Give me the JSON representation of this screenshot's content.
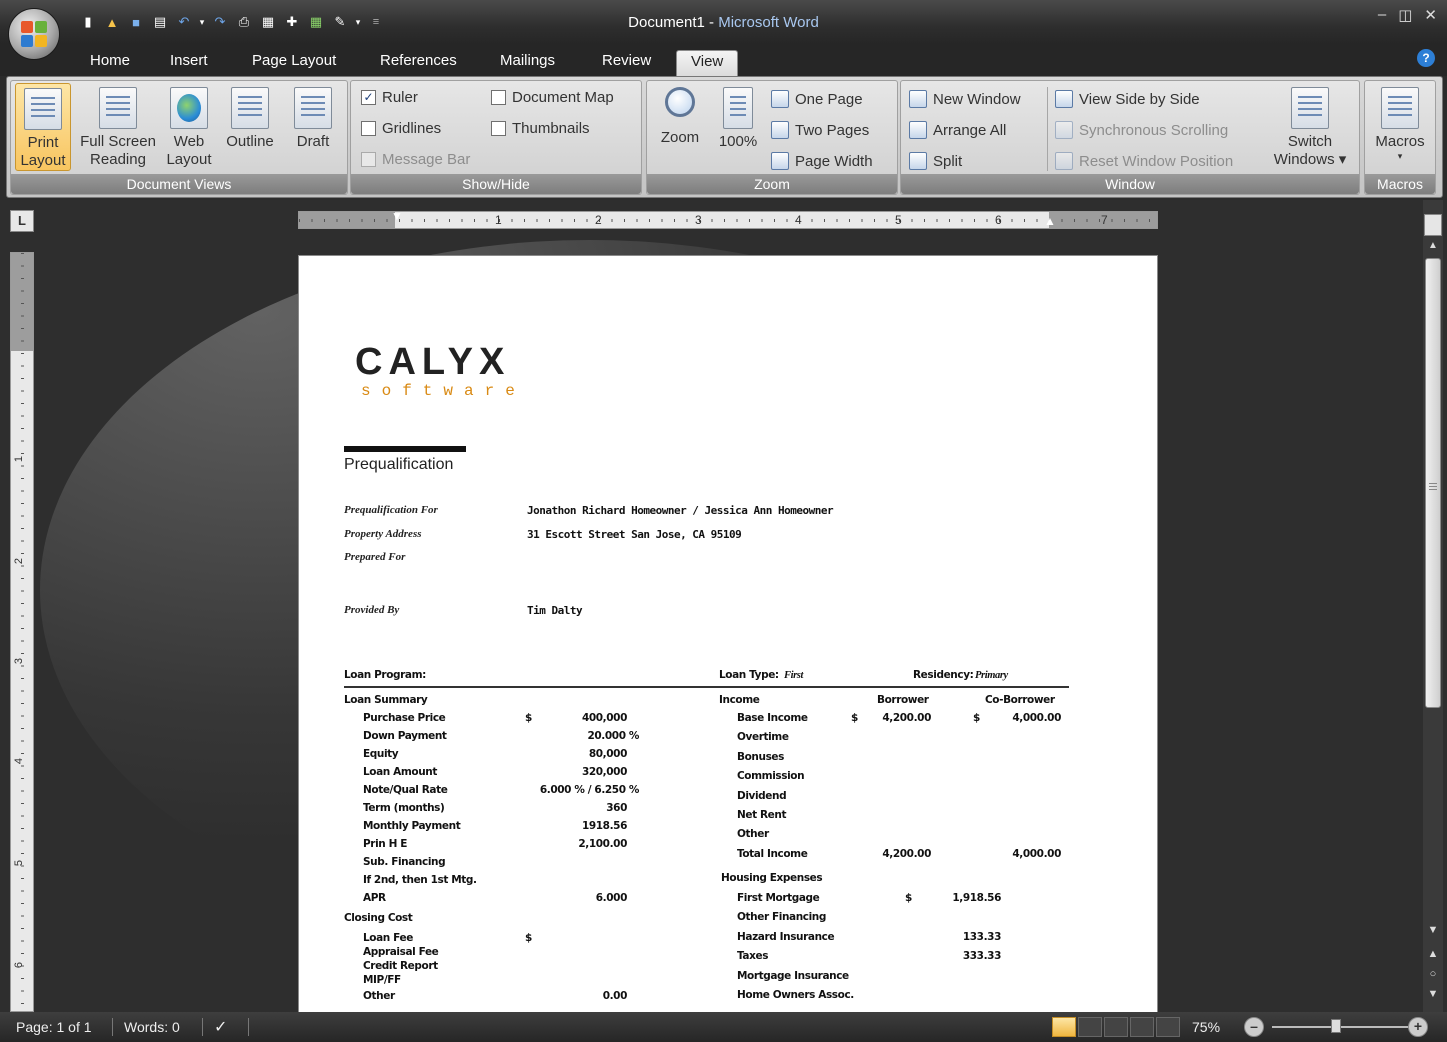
{
  "window": {
    "doc_title": "Document1",
    "separator": " - ",
    "app_name": "Microsoft Word"
  },
  "tabs": [
    "Home",
    "Insert",
    "Page Layout",
    "References",
    "Mailings",
    "Review",
    "View"
  ],
  "active_tab": "View",
  "ribbon": {
    "document_views": {
      "label": "Document Views",
      "print_layout": [
        "Print",
        "Layout"
      ],
      "full_screen": [
        "Full Screen",
        "Reading"
      ],
      "web_layout": [
        "Web",
        "Layout"
      ],
      "outline": "Outline",
      "draft": "Draft"
    },
    "show_hide": {
      "label": "Show/Hide",
      "ruler": "Ruler",
      "gridlines": "Gridlines",
      "message_bar": "Message Bar",
      "document_map": "Document Map",
      "thumbnails": "Thumbnails"
    },
    "zoom": {
      "label": "Zoom",
      "zoom": "Zoom",
      "hundred": "100%",
      "one_page": "One Page",
      "two_pages": "Two Pages",
      "page_width": "Page Width"
    },
    "window": {
      "label": "Window",
      "new_window": "New Window",
      "arrange_all": "Arrange All",
      "split": "Split",
      "side_by_side": "View Side by Side",
      "sync_scrolling": "Synchronous Scrolling",
      "reset_position": "Reset Window Position",
      "switch_windows": [
        "Switch",
        "Windows ▾"
      ]
    },
    "macros": {
      "label": "Macros",
      "macros": "Macros",
      "arrow": "▾"
    }
  },
  "ruler": {
    "h_numbers": [
      "1",
      "2",
      "3",
      "4",
      "5",
      "6",
      "7"
    ],
    "v_numbers": [
      "1",
      "2",
      "3",
      "4",
      "5",
      "6"
    ],
    "corner": "L"
  },
  "document": {
    "logo_main": "CALYX",
    "logo_sub": "software",
    "heading": "Prequalification",
    "fields": [
      {
        "label": "Prequalification For",
        "value": "Jonathon Richard Homeowner / Jessica Ann Homeowner"
      },
      {
        "label": "Property Address",
        "value": "31 Escott Street San Jose, CA 95109"
      },
      {
        "label": "Prepared For",
        "value": ""
      },
      {
        "label": "Provided By",
        "value": "Tim Dalty"
      }
    ],
    "loan_program_label": "Loan Program:",
    "loan_type_label": "Loan Type:",
    "loan_type_value": "First",
    "residency_label": "Residency:",
    "residency_value": "Primary",
    "loan_summary": "Loan Summary",
    "summary_rows": [
      {
        "label": "Purchase Price",
        "dollar": "$",
        "value": "400,000"
      },
      {
        "label": "Down Payment",
        "dollar": "",
        "value": "20.000 %"
      },
      {
        "label": "Equity",
        "dollar": "",
        "value": "80,000"
      },
      {
        "label": "Loan Amount",
        "dollar": "",
        "value": "320,000"
      },
      {
        "label": "Note/Qual Rate",
        "dollar": "",
        "value": "6.000 % / 6.250 %"
      },
      {
        "label": "Term (months)",
        "dollar": "",
        "value": "360"
      },
      {
        "label": "Monthly Payment",
        "dollar": "",
        "value": "1918.56"
      },
      {
        "label": "Prin H E",
        "dollar": "",
        "value": "2,100.00"
      },
      {
        "label": "Sub. Financing",
        "dollar": "",
        "value": ""
      },
      {
        "label": "If 2nd, then 1st Mtg.",
        "dollar": "",
        "value": ""
      },
      {
        "label": "APR",
        "dollar": "",
        "value": "6.000"
      }
    ],
    "closing_cost": "Closing Cost",
    "closing_rows": [
      {
        "label": "Loan Fee",
        "dollar": "$",
        "value": ""
      },
      {
        "label": "Appraisal Fee",
        "dollar": "",
        "value": ""
      },
      {
        "label": "Credit Report",
        "dollar": "",
        "value": ""
      },
      {
        "label": "MIP/FF",
        "dollar": "",
        "value": ""
      },
      {
        "label": "Other",
        "dollar": "",
        "value": "0.00"
      }
    ],
    "income_label": "Income",
    "borrower_label": "Borrower",
    "coborrower_label": "Co-Borrower",
    "income_rows": [
      {
        "label": "Base Income",
        "b_dollar": "$",
        "b": "4,200.00",
        "c_dollar": "$",
        "c": "4,000.00"
      },
      {
        "label": "Overtime",
        "b_dollar": "",
        "b": "",
        "c_dollar": "",
        "c": ""
      },
      {
        "label": "Bonuses",
        "b_dollar": "",
        "b": "",
        "c_dollar": "",
        "c": ""
      },
      {
        "label": "Commission",
        "b_dollar": "",
        "b": "",
        "c_dollar": "",
        "c": ""
      },
      {
        "label": "Dividend",
        "b_dollar": "",
        "b": "",
        "c_dollar": "",
        "c": ""
      },
      {
        "label": "Net Rent",
        "b_dollar": "",
        "b": "",
        "c_dollar": "",
        "c": ""
      },
      {
        "label": "Other",
        "b_dollar": "",
        "b": "",
        "c_dollar": "",
        "c": ""
      },
      {
        "label": "Total Income",
        "b_dollar": "",
        "b": "4,200.00",
        "c_dollar": "",
        "c": "4,000.00"
      }
    ],
    "housing_label": "Housing Expenses",
    "housing_rows": [
      {
        "label": "First Mortgage",
        "dollar": "$",
        "value": "1,918.56"
      },
      {
        "label": "Other Financing",
        "dollar": "",
        "value": ""
      },
      {
        "label": "Hazard Insurance",
        "dollar": "",
        "value": "133.33"
      },
      {
        "label": "Taxes",
        "dollar": "",
        "value": "333.33"
      },
      {
        "label": "Mortgage Insurance",
        "dollar": "",
        "value": ""
      },
      {
        "label": "Home Owners Assoc.",
        "dollar": "",
        "value": ""
      }
    ]
  },
  "status": {
    "page": "Page: 1 of 1",
    "words": "Words: 0",
    "zoom": "75%",
    "zoom_fraction": 0.45
  }
}
